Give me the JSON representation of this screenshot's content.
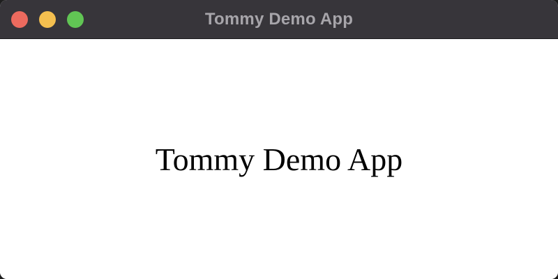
{
  "window": {
    "title": "Tommy Demo App",
    "controls": [
      {
        "name": "close",
        "color": "#ec6a5e"
      },
      {
        "name": "minimize",
        "color": "#f4bf4f"
      },
      {
        "name": "zoom",
        "color": "#61c554"
      }
    ],
    "titlebar_color": "#37353a"
  },
  "content": {
    "label": "Tommy Demo App",
    "background": "#ffffff"
  }
}
